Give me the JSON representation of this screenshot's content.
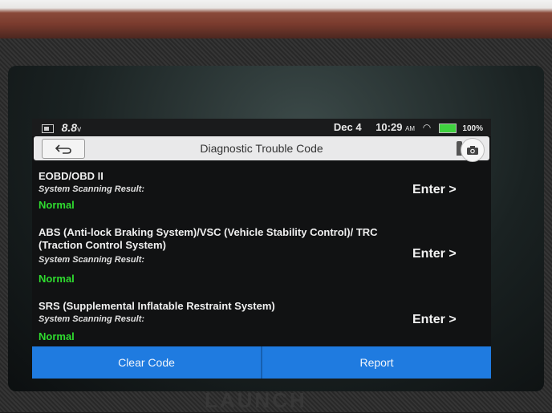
{
  "status_bar": {
    "voltage": "8.8",
    "voltage_unit": "v",
    "date": "Dec 4",
    "time": "10:29",
    "ampm": "AM",
    "battery_pct": "100%"
  },
  "header": {
    "title": "Diagnostic Trouble Code",
    "back_icon": "back-arrow-icon",
    "camera_icon": "camera-icon"
  },
  "systems": [
    {
      "name": "EOBD/OBD II",
      "scan_label": "System Scanning Result:",
      "status": "Normal",
      "enter_label": "Enter >"
    },
    {
      "name": "ABS (Anti-lock Braking System)/VSC (Vehicle Stability Control)/ TRC (Traction Control System)",
      "scan_label": "System Scanning Result:",
      "status": "Normal",
      "enter_label": "Enter >"
    },
    {
      "name": "SRS (Supplemental Inflatable Restraint System)",
      "scan_label": "System Scanning Result:",
      "status": "Normal",
      "enter_label": "Enter >"
    }
  ],
  "footer": {
    "clear_label": "Clear Code",
    "report_label": "Report"
  },
  "device": {
    "brand": "LAUNCH"
  },
  "colors": {
    "normal_status": "#2fdc2f",
    "button_blue": "#1f7be0"
  }
}
